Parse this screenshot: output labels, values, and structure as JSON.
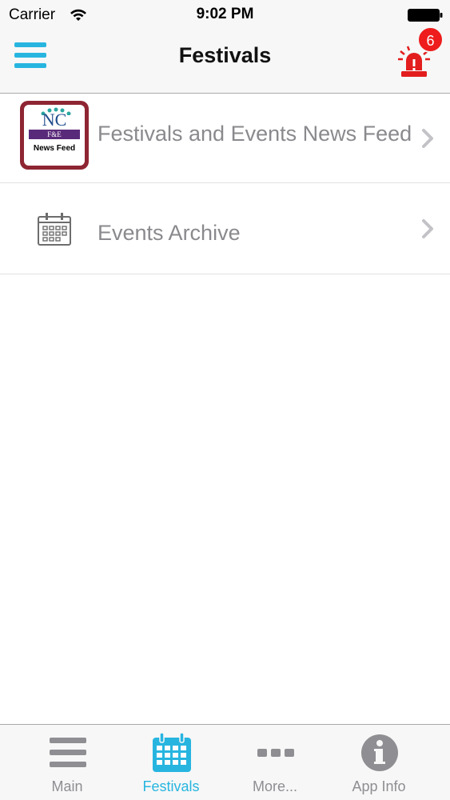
{
  "status_bar": {
    "carrier": "Carrier",
    "time": "9:02 PM"
  },
  "nav": {
    "title": "Festivals",
    "alarm_badge_count": "6",
    "accent_color": "#27b5e0",
    "alarm_color": "#e31d1d"
  },
  "list": {
    "items": [
      {
        "label": "Festivals and Events News Feed",
        "icon": "nc-fe-news-feed-logo",
        "logo": {
          "top": "NC",
          "band": "F&E",
          "bottom": "News Feed"
        }
      },
      {
        "label": "Events Archive",
        "icon": "calendar-icon"
      }
    ]
  },
  "tabs": [
    {
      "label": "Main",
      "icon": "hamburger-icon"
    },
    {
      "label": "Festivals",
      "icon": "calendar-icon",
      "active": true
    },
    {
      "label": "More...",
      "icon": "more-dots-icon"
    },
    {
      "label": "App Info",
      "icon": "info-icon"
    }
  ]
}
